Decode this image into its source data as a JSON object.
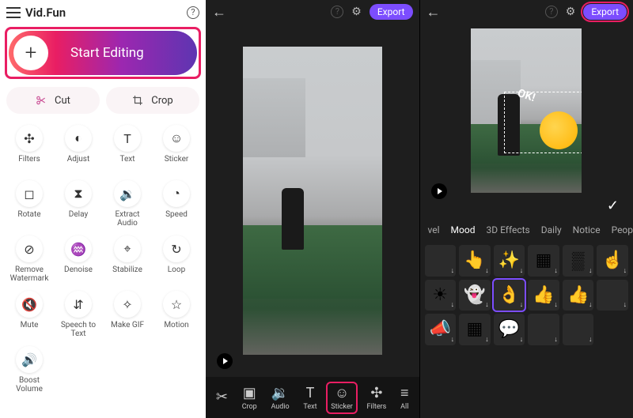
{
  "left": {
    "title": "Vid.Fun",
    "start": "Start Editing",
    "cut": "Cut",
    "crop": "Crop",
    "tools": [
      {
        "label": "Filters",
        "icon": "✣"
      },
      {
        "label": "Adjust",
        "icon": "◐"
      },
      {
        "label": "Text",
        "icon": "T"
      },
      {
        "label": "Sticker",
        "icon": "☺"
      },
      {
        "label": "Rotate",
        "icon": "◻"
      },
      {
        "label": "Delay",
        "icon": "⧗"
      },
      {
        "label": "Extract Audio",
        "icon": "🔉"
      },
      {
        "label": "Speed",
        "icon": "◔"
      },
      {
        "label": "Remove Watermark",
        "icon": "⊘"
      },
      {
        "label": "Denoise",
        "icon": "♒"
      },
      {
        "label": "Stabilize",
        "icon": "⌖"
      },
      {
        "label": "Loop",
        "icon": "↻"
      },
      {
        "label": "Mute",
        "icon": "🔇"
      },
      {
        "label": "Speech to Text",
        "icon": "⇵"
      },
      {
        "label": "Make GIF",
        "icon": "✧"
      },
      {
        "label": "Motion",
        "icon": "☆"
      },
      {
        "label": "Boost Volume",
        "icon": "🔊"
      }
    ]
  },
  "mid": {
    "export": "Export",
    "bottom": [
      {
        "label": "",
        "icon": "✂"
      },
      {
        "label": "Crop",
        "icon": "▣"
      },
      {
        "label": "Audio",
        "icon": "🔉"
      },
      {
        "label": "Text",
        "icon": "T"
      },
      {
        "label": "Sticker",
        "icon": "☺"
      },
      {
        "label": "Filters",
        "icon": "✣"
      },
      {
        "label": "All",
        "icon": "≡"
      }
    ]
  },
  "right": {
    "export": "Export",
    "okText": "OK!",
    "tabs": [
      "vel",
      "Mood",
      "3D Effects",
      "Daily",
      "Notice",
      "People"
    ],
    "stickers": [
      "",
      "👆",
      "✨",
      "▦",
      "▒",
      "☝",
      "☀",
      "👻",
      "👌",
      "👍",
      "👍",
      "",
      "📣",
      "▦",
      "💬",
      "",
      ""
    ],
    "selectedStickerIndex": 8
  }
}
